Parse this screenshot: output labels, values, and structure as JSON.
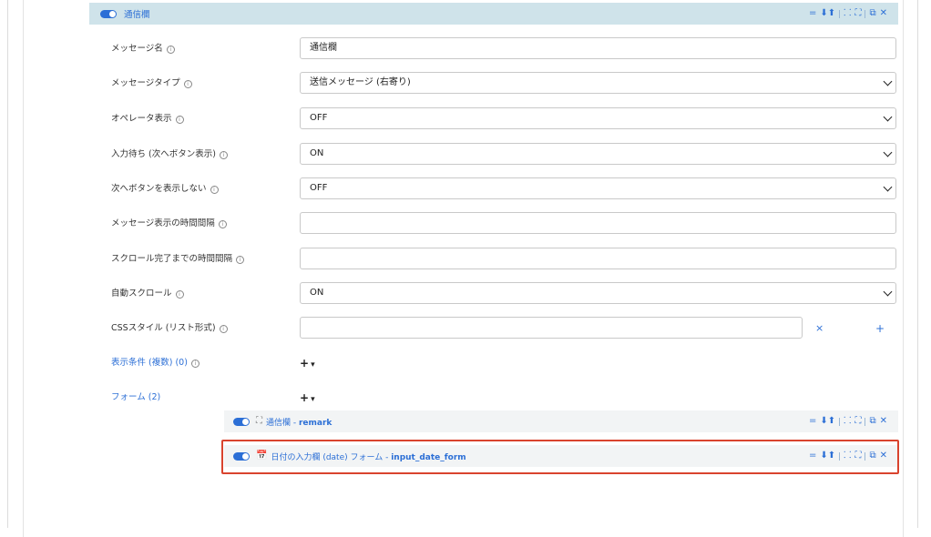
{
  "header": {
    "title": "通信欄",
    "controls": {
      "grip": "=",
      "down": "⬇",
      "up": "⬆",
      "collapse": "⸬",
      "expand": "⛶",
      "copy": "⧉",
      "close": "✕"
    }
  },
  "fields": [
    {
      "label": "メッセージ名",
      "value": "通信欄",
      "type": "text"
    },
    {
      "label": "メッセージタイプ",
      "value": "送信メッセージ (右寄り)",
      "type": "select"
    },
    {
      "label": "オペレータ表示",
      "value": "OFF",
      "type": "select"
    },
    {
      "label": "入力待ち (次へボタン表示)",
      "value": "ON",
      "type": "select"
    },
    {
      "label": "次へボタンを表示しない",
      "value": "OFF",
      "type": "select"
    },
    {
      "label": "メッセージ表示の時間間隔",
      "value": "",
      "type": "text"
    },
    {
      "label": "スクロール完了までの時間間隔",
      "value": "",
      "type": "text"
    },
    {
      "label": "自動スクロール",
      "value": "ON",
      "type": "select"
    },
    {
      "label": "CSSスタイル (リスト形式)",
      "value": "",
      "type": "text"
    }
  ],
  "css_list": {
    "remove": "×",
    "add": "+"
  },
  "conditions": {
    "label": "表示条件 (複数) (0)",
    "add": "+",
    "caret": "▾"
  },
  "forms": {
    "label": "フォーム (2)",
    "add": "+",
    "caret": "▾"
  },
  "sub_items": [
    {
      "title": "通信欄 - ",
      "id": "remark",
      "icon": "expand-icon"
    },
    {
      "title": "日付の入力欄 (date) フォーム - ",
      "id": "input_date_form",
      "icon": "calendar-icon"
    }
  ],
  "info_glyph": "i",
  "colors": {
    "accent": "#2c6fd6",
    "header_bg": "#cfe3ea",
    "highlight": "#d9432e"
  }
}
